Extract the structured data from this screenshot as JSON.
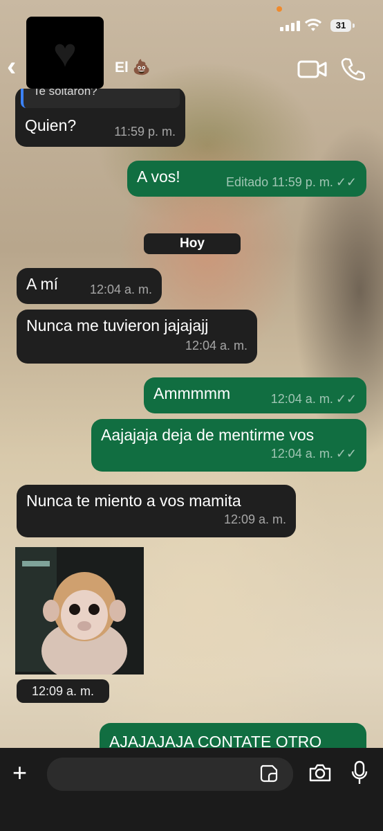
{
  "status_bar": {
    "battery": "31"
  },
  "header": {
    "contact_name": "El 💩"
  },
  "chat": {
    "quoted_reply": "Te soltaron?",
    "date_divider": "Hoy",
    "messages": [
      {
        "direction": "in",
        "text": "Quien?",
        "time": "11:59 p. m."
      },
      {
        "direction": "out",
        "text": "A vos!",
        "time": "Editado 11:59 p. m."
      },
      {
        "direction": "in",
        "text": "A mí",
        "time": "12:04 a. m."
      },
      {
        "direction": "in",
        "text": "Nunca me tuvieron jajajajj",
        "time": "12:04 a. m."
      },
      {
        "direction": "out",
        "text": "Ammmmm",
        "time": "12:04 a. m."
      },
      {
        "direction": "out",
        "text": "Aajajaja deja de mentirme vos",
        "time": "12:04 a. m."
      },
      {
        "direction": "in",
        "text": "Nunca te miento a vos mamita",
        "time": "12:09 a. m."
      },
      {
        "direction": "in",
        "text": "",
        "time": "12:09 a. m.",
        "kind": "sticker"
      },
      {
        "direction": "out",
        "text": "AJAJAJAJA CONTATE OTRO",
        "time": ""
      }
    ]
  },
  "colors": {
    "incoming": "#1f1f1f",
    "outgoing": "#116e41",
    "status_dot": "#f08a2c"
  },
  "icons": [
    "back-icon",
    "video-call-icon",
    "phone-call-icon",
    "plus-icon",
    "sticker-icon",
    "camera-icon",
    "microphone-icon",
    "read-receipt-icon"
  ]
}
